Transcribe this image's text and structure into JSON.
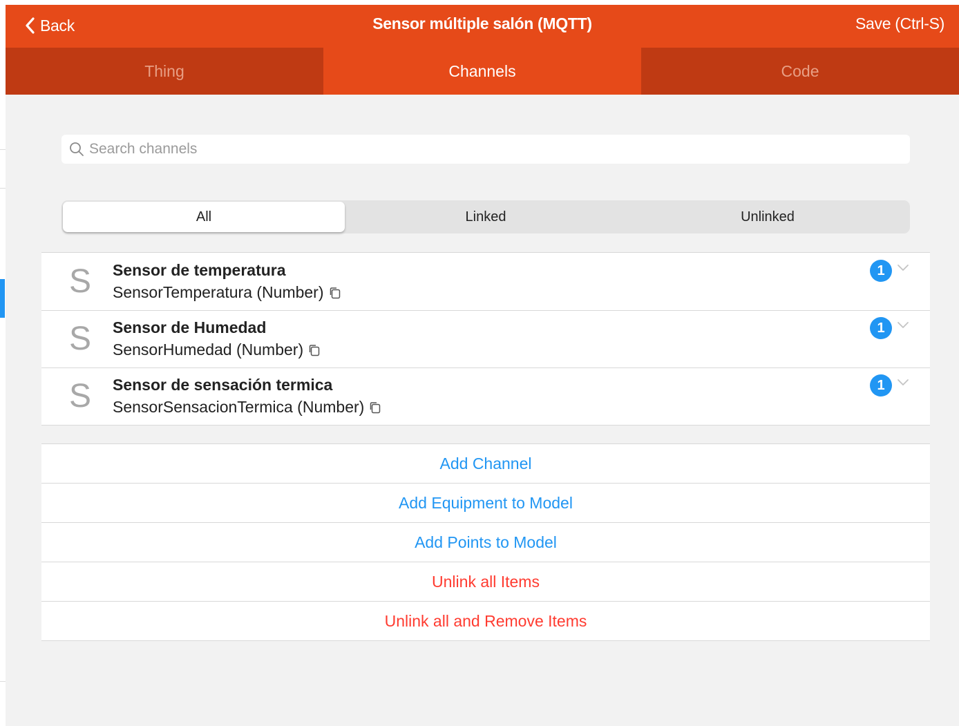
{
  "navbar": {
    "back_label": "Back",
    "title": "Sensor múltiple salón (MQTT)",
    "save_label": "Save (Ctrl-S)"
  },
  "tabs": [
    {
      "label": "Thing",
      "active": false
    },
    {
      "label": "Channels",
      "active": true
    },
    {
      "label": "Code",
      "active": false
    }
  ],
  "search": {
    "placeholder": "Search channels",
    "value": ""
  },
  "filter": {
    "options": [
      "All",
      "Linked",
      "Unlinked"
    ],
    "selected": "All"
  },
  "channels": [
    {
      "letter": "S",
      "title": "Sensor de temperatura",
      "subtitle": "SensorTemperatura (Number)",
      "linked_count": "1"
    },
    {
      "letter": "S",
      "title": "Sensor de Humedad",
      "subtitle": "SensorHumedad (Number)",
      "linked_count": "1"
    },
    {
      "letter": "S",
      "title": "Sensor de sensación termica",
      "subtitle": "SensorSensacionTermica (Number)",
      "linked_count": "1"
    }
  ],
  "actions": {
    "add_channel": "Add Channel",
    "add_equipment": "Add Equipment to Model",
    "add_points": "Add Points to Model",
    "unlink_all": "Unlink all Items",
    "unlink_remove": "Unlink all and Remove Items"
  },
  "colors": {
    "accent": "#e64a19",
    "tab_inactive": "#bf3a13",
    "link_blue": "#2196f3",
    "danger_red": "#ff3b30",
    "badge_blue": "#2196f3"
  }
}
